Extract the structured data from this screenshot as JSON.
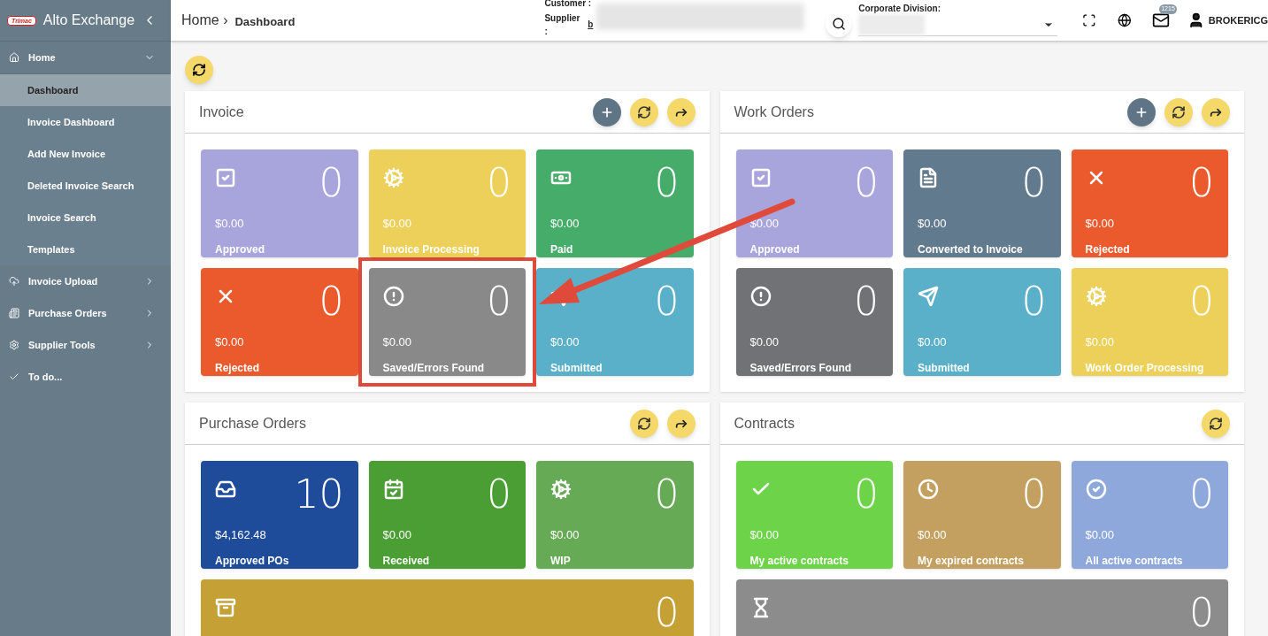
{
  "app": {
    "logo_text": "Trimac",
    "title": "Alto Exchange"
  },
  "sidebar": {
    "items": [
      {
        "label": "Home",
        "kind": "home",
        "expanded": true,
        "children": [
          {
            "label": "Dashboard",
            "selected": true
          },
          {
            "label": "Invoice Dashboard",
            "selected": false
          },
          {
            "label": "Add New Invoice",
            "selected": false
          },
          {
            "label": "Deleted Invoice Search",
            "selected": false
          },
          {
            "label": "Invoice Search",
            "selected": false
          },
          {
            "label": "Templates",
            "selected": false
          }
        ]
      },
      {
        "label": "Invoice Upload",
        "kind": "upload",
        "expanded": false
      },
      {
        "label": "Purchase Orders",
        "kind": "orders",
        "expanded": false
      },
      {
        "label": "Supplier Tools",
        "kind": "tools",
        "expanded": false
      },
      {
        "label": "To do...",
        "kind": "todo"
      }
    ]
  },
  "header": {
    "breadcrumb": [
      "Home ›",
      "Dashboard"
    ],
    "customer_label": "Customer :",
    "supplier_label": "Supplier :",
    "supplier_value": "b",
    "division_label": "Corporate Division:",
    "badge": "1215",
    "user": "BROKERICG"
  },
  "panels": [
    {
      "title": "Invoice",
      "actions": [
        {
          "kind": "add"
        },
        {
          "kind": "refresh"
        },
        {
          "kind": "forward"
        }
      ],
      "tiles": [
        {
          "kind": "approved",
          "count": "0",
          "amount": "$0.00",
          "label": "Approved",
          "color": "#a8a4dc"
        },
        {
          "kind": "processing",
          "count": "0",
          "amount": "$0.00",
          "label": "Invoice Processing",
          "color": "#ecd05a"
        },
        {
          "kind": "paid",
          "count": "0",
          "amount": "$0.00",
          "label": "Paid",
          "color": "#46ac6a"
        },
        {
          "kind": "rejected",
          "count": "0",
          "amount": "$0.00",
          "label": "Rejected",
          "color": "#ea5a2c"
        },
        {
          "kind": "errors",
          "count": "0",
          "amount": "$0.00",
          "label": "Saved/Errors Found",
          "color": "#898989",
          "highlighted": true
        },
        {
          "kind": "submitted",
          "count": "0",
          "amount": "$0.00",
          "label": "Submitted",
          "color": "#5ab0c8"
        }
      ]
    },
    {
      "title": "Work Orders",
      "actions": [
        {
          "kind": "add"
        },
        {
          "kind": "refresh"
        },
        {
          "kind": "forward"
        }
      ],
      "tiles": [
        {
          "kind": "approved",
          "count": "0",
          "amount": "$0.00",
          "label": "Approved",
          "color": "#a8a4dc"
        },
        {
          "kind": "document",
          "count": "0",
          "amount": "$0.00",
          "label": "Converted to Invoice",
          "color": "#627a8e"
        },
        {
          "kind": "rejected",
          "count": "0",
          "amount": "$0.00",
          "label": "Rejected",
          "color": "#ea5a2c"
        },
        {
          "kind": "errors",
          "count": "0",
          "amount": "$0.00",
          "label": "Saved/Errors Found",
          "color": "#707275"
        },
        {
          "kind": "submitted",
          "count": "0",
          "amount": "$0.00",
          "label": "Submitted",
          "color": "#5ab0c8"
        },
        {
          "kind": "processing",
          "count": "0",
          "amount": "$0.00",
          "label": "Work Order Processing",
          "color": "#ecd05a"
        }
      ]
    },
    {
      "title": "Purchase Orders",
      "actions": [
        {
          "kind": "refresh"
        },
        {
          "kind": "forward"
        }
      ],
      "tiles": [
        {
          "kind": "inbox",
          "count": "10",
          "amount": "$4,162.48",
          "label": "Approved POs",
          "color": "#1e4b9a"
        },
        {
          "kind": "received",
          "count": "0",
          "amount": "$0.00",
          "label": "Received",
          "color": "#4a9e34"
        },
        {
          "kind": "processing",
          "count": "0",
          "amount": "$0.00",
          "label": "WIP",
          "color": "#66aa55"
        },
        {
          "kind": "archive",
          "count": "0",
          "wide": true,
          "color": "#c4a035"
        }
      ]
    },
    {
      "title": "Contracts",
      "actions": [
        {
          "kind": "refresh"
        }
      ],
      "tiles": [
        {
          "kind": "active",
          "count": "0",
          "amount": "$0.00",
          "label": "My active contracts",
          "color": "#6dd44a"
        },
        {
          "kind": "expired",
          "count": "0",
          "amount": "$0.00",
          "label": "My expired contracts",
          "color": "#c4a060"
        },
        {
          "kind": "all",
          "count": "0",
          "amount": "$0.00",
          "label": "All active contracts",
          "color": "#8fa8dc"
        },
        {
          "kind": "pending",
          "count": "0",
          "wide": true,
          "color": "#8c8c8c"
        }
      ]
    }
  ]
}
